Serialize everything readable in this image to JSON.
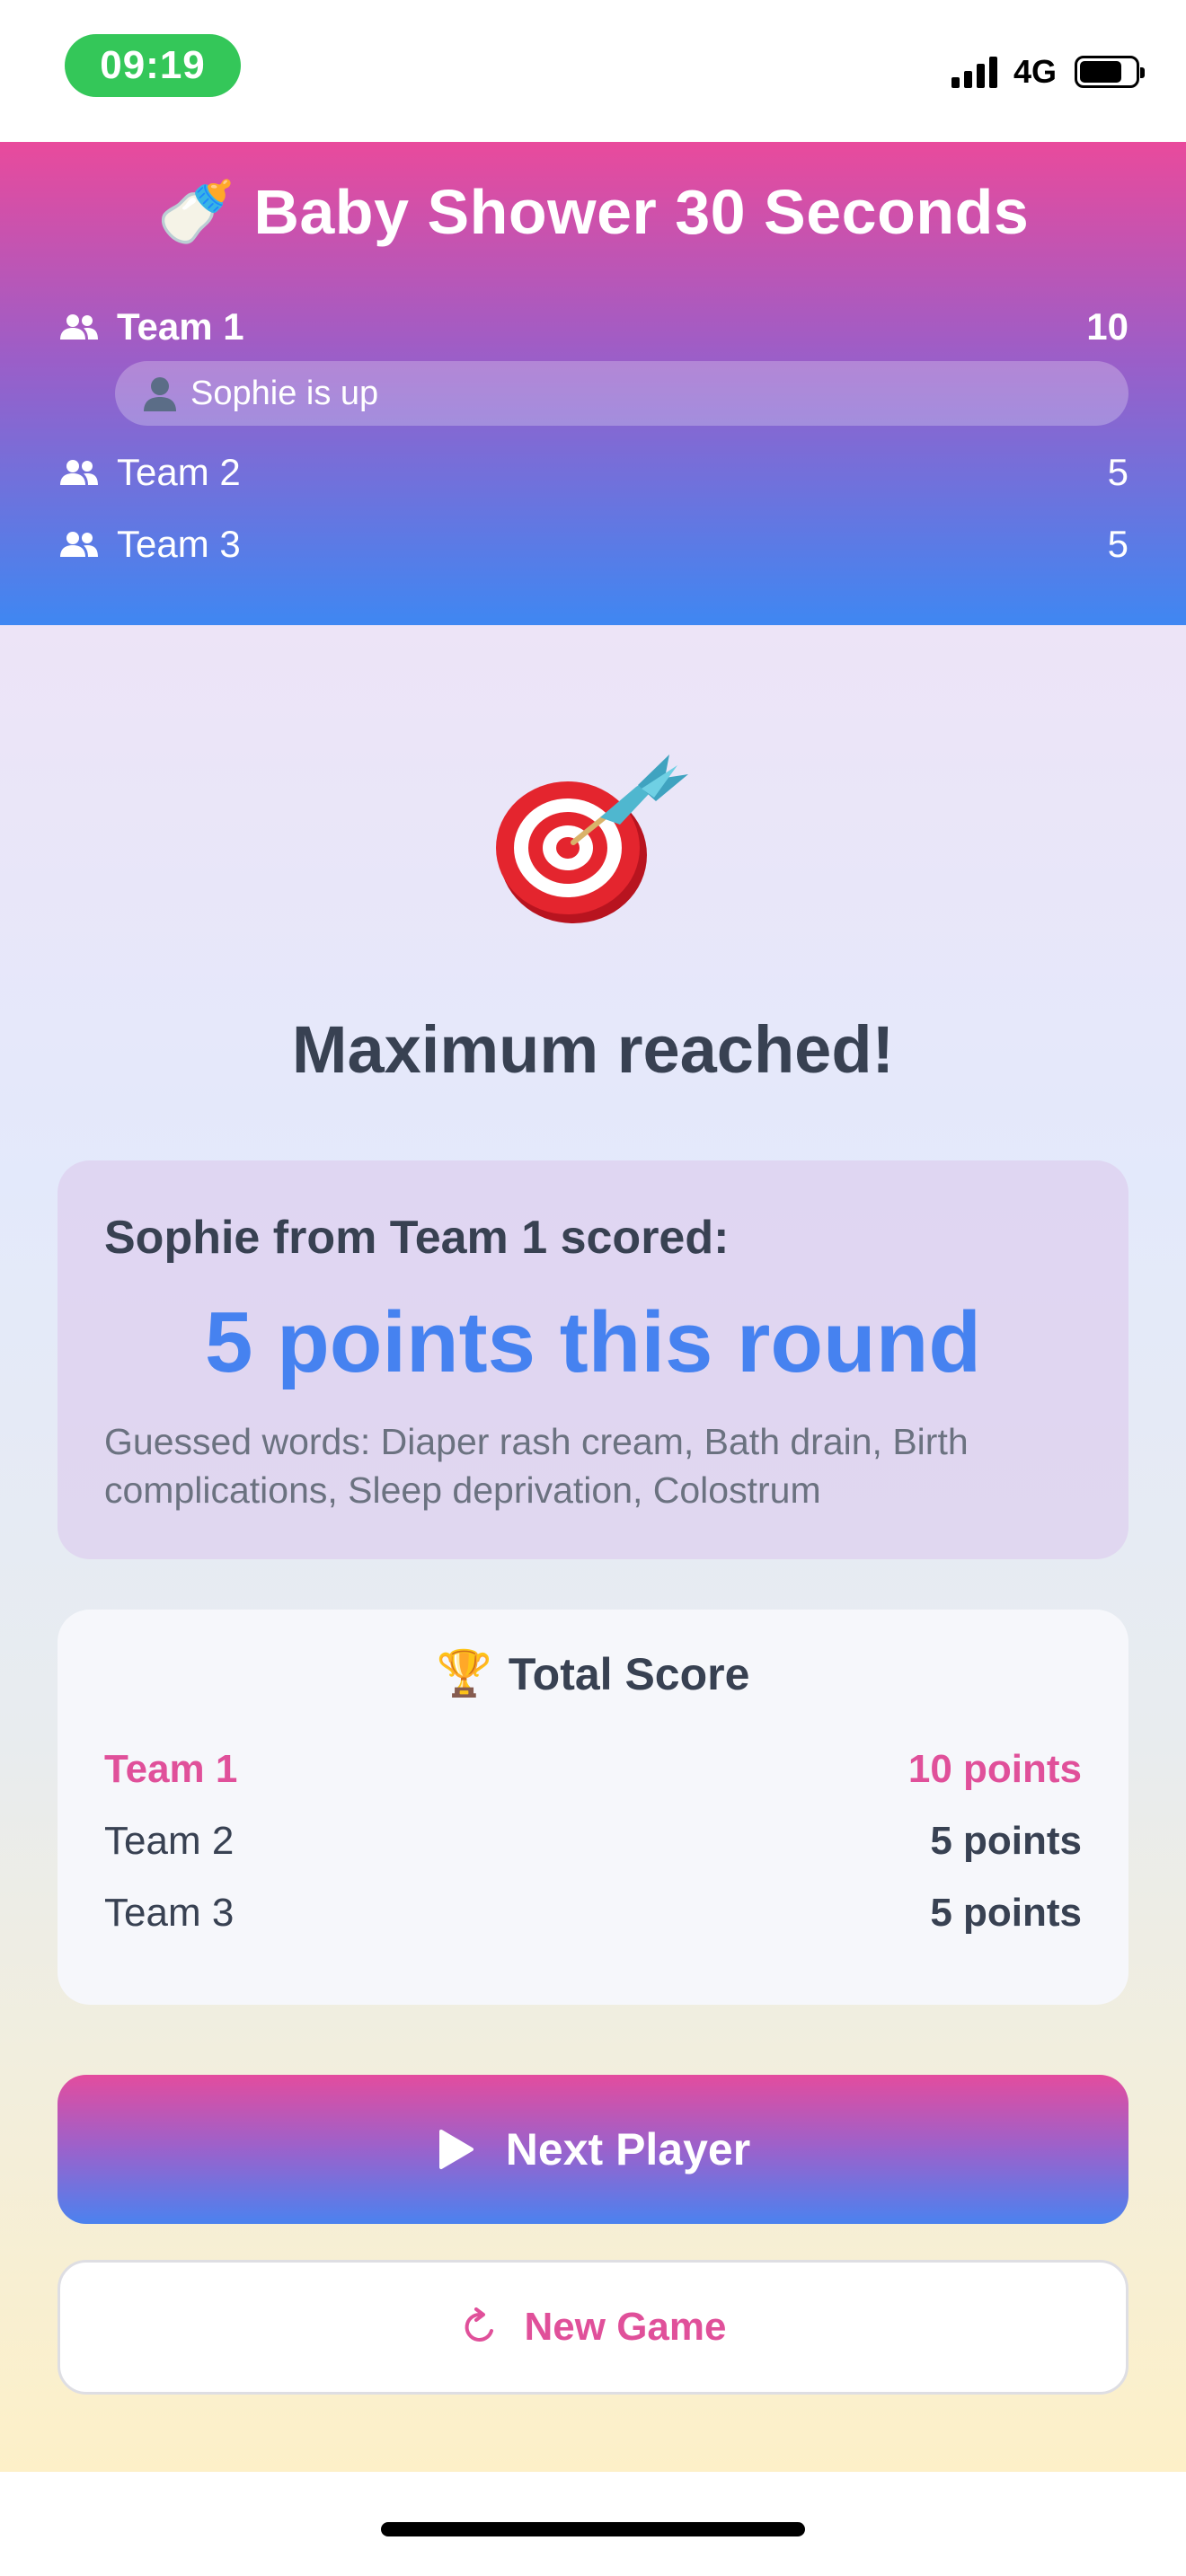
{
  "status_bar": {
    "time": "09:19",
    "network": "4G"
  },
  "header": {
    "title_emoji": "🍼",
    "title": "Baby Shower 30 Seconds",
    "teams": [
      {
        "name": "Team 1",
        "score": "10",
        "active": true
      },
      {
        "name": "Team 2",
        "score": "5",
        "active": false
      },
      {
        "name": "Team 3",
        "score": "5",
        "active": false
      }
    ],
    "current_player": "Sophie is up"
  },
  "result": {
    "icon": "target-dart-icon",
    "heading": "Maximum reached!",
    "scored_line": "Sophie from Team 1 scored:",
    "points_line": "5 points this round",
    "guessed_words": "Guessed words: Diaper rash cream, Bath drain, Birth complications, Sleep deprivation, Colostrum"
  },
  "total_score": {
    "title_emoji": "🏆",
    "title": "Total Score",
    "rows": [
      {
        "team": "Team 1",
        "points": "10 points",
        "leader": true
      },
      {
        "team": "Team 2",
        "points": "5 points",
        "leader": false
      },
      {
        "team": "Team 3",
        "points": "5 points",
        "leader": false
      }
    ]
  },
  "actions": {
    "next_player_label": "Next Player",
    "new_game_label": "New Game"
  },
  "colors": {
    "accent_pink": "#e0509a",
    "accent_blue": "#4682f0",
    "status_green": "#34c759",
    "text_dark": "#384152"
  }
}
